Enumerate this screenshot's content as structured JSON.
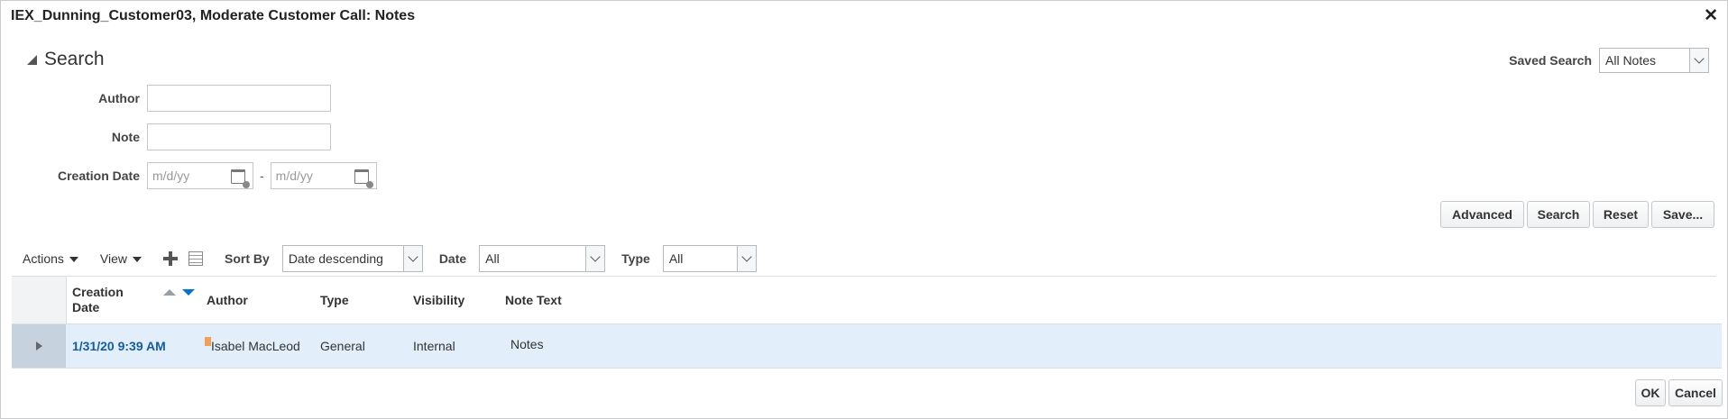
{
  "dialog": {
    "title": "IEX_Dunning_Customer03, Moderate Customer Call: Notes",
    "close_glyph": "✕"
  },
  "search": {
    "title": "Search",
    "saved_search_label": "Saved Search",
    "saved_search_value": "All Notes",
    "author_label": "Author",
    "note_label": "Note",
    "creation_date_label": "Creation Date",
    "date_from_placeholder": "m/d/yy",
    "date_to_placeholder": "m/d/yy",
    "date_separator": "-",
    "buttons": {
      "advanced": "Advanced",
      "search": "Search",
      "reset": "Reset",
      "save": "Save..."
    }
  },
  "toolbar": {
    "actions": "Actions",
    "view": "View",
    "sort_by_label": "Sort By",
    "sort_by_value": "Date descending",
    "date_label": "Date",
    "date_value": "All",
    "type_label": "Type",
    "type_value": "All"
  },
  "table": {
    "columns": {
      "creation_date_line1": "Creation",
      "creation_date_line2": "Date",
      "author": "Author",
      "type": "Type",
      "visibility": "Visibility",
      "note_text": "Note Text"
    },
    "rows": [
      {
        "creation_date": "1/31/20 9:39 AM",
        "author": "Isabel MacLeod",
        "type": "General",
        "visibility": "Internal",
        "note_text": "Notes"
      }
    ]
  },
  "footer": {
    "ok": "OK",
    "cancel": "Cancel"
  },
  "colors": {
    "accent_link": "#145c9e",
    "selected_row": "#e2eef9",
    "sort_active": "#0572ce"
  }
}
